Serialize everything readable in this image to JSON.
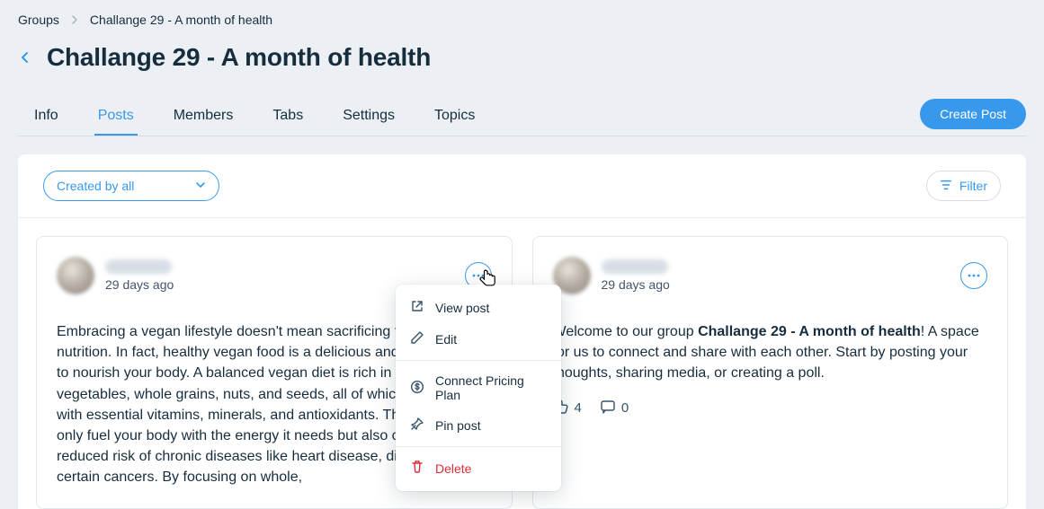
{
  "breadcrumb": {
    "root": "Groups",
    "current": "Challange 29 - A month of health"
  },
  "page_title": "Challange 29 - A month of health",
  "tabs": {
    "info": "Info",
    "posts": "Posts",
    "members": "Members",
    "tabs": "Tabs",
    "settings": "Settings",
    "topics": "Topics"
  },
  "create_post_label": "Create Post",
  "toolbar": {
    "created_by": "Created by all",
    "filter": "Filter"
  },
  "menu": {
    "view": "View post",
    "edit": "Edit",
    "pricing": "Connect Pricing Plan",
    "pin": "Pin post",
    "delete": "Delete"
  },
  "posts": [
    {
      "timestamp": "29 days ago",
      "body": "Embracing a vegan lifestyle doesn't mean sacrificing flavor or nutrition. In fact, healthy vegan food is a delicious and vibrant way to nourish your body. A balanced vegan diet is rich in fruits, vegetables, whole grains, nuts, and seeds, all of which are packed with essential vitamins, minerals, and antioxidants. These foods not only fuel your body with the energy it needs but also contribute to a reduced risk of chronic diseases like heart disease, diabetes, and certain cancers. By focusing on whole,"
    },
    {
      "timestamp": "29 days ago",
      "body_prefix": "Welcome to our group ",
      "body_bold": "Challange 29 - A month of health",
      "body_suffix": "! A space for us to connect and share with each other. Start by posting your thoughts, sharing media, or creating a poll.",
      "likes": "4",
      "comments": "0"
    }
  ]
}
